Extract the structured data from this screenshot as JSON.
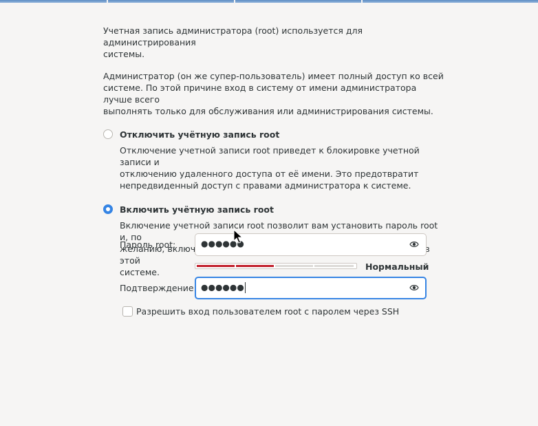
{
  "intro": {
    "paragraph1": "Учетная запись администратора (root) используется для администрирования\nсистемы.",
    "paragraph2": "Администратор (он же супер-пользователь) имеет полный доступ ко всей\nсистеме. По этой причине вход в систему от имени администратора лучше всего\nвыполнять только для обслуживания или администрирования системы."
  },
  "options": [
    {
      "title": "Отключить учётную запись root",
      "description": "Отключение учетной записи root приведет к блокировке учетной записи и\nотключению удаленного доступа от её имени. Это предотвратит\nнепредвиденный доступ с правами администратора к системе.",
      "selected": false
    },
    {
      "title": "Включить учётную запись root",
      "description": "Включение учетной записи root позволит вам установить пароль root и, по\nжеланию, включить удаленный доступ от имени администратора в этой\nсистеме.",
      "selected": true
    }
  ],
  "password": {
    "label": "Пароль root:",
    "masked_value": "●●●●●●",
    "reveal_icon": "eye-icon"
  },
  "confirm": {
    "label": "Подтверждение:",
    "masked_value": "●●●●●●",
    "reveal_icon": "eye-icon",
    "focused": true
  },
  "strength": {
    "label": "Нормальный",
    "level_fraction": 0.5,
    "filled_color": "#c01c28",
    "empty_color": "#dcdad7"
  },
  "ssh_option": {
    "label": "Разрешить вход пользователем root с паролем через SSH",
    "checked": false
  },
  "colors": {
    "accent": "#3584e4",
    "strength_red": "#c01c28"
  }
}
